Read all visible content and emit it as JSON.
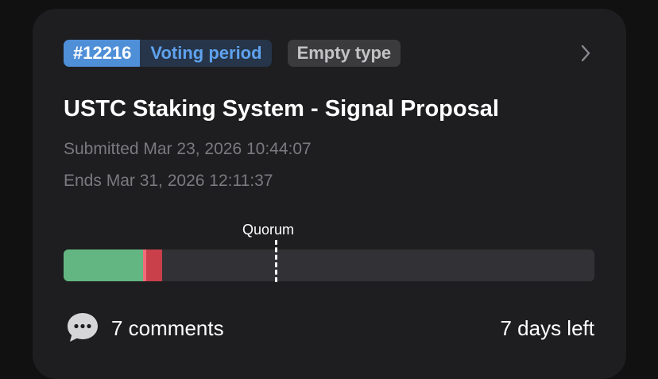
{
  "proposal": {
    "id_label": "#12216",
    "status_label": "Voting period",
    "type_label": "Empty type",
    "title": "USTC Staking System - Signal Proposal",
    "submitted": "Submitted Mar 23, 2026 10:44:07",
    "ends": "Ends Mar 31, 2026 12:11:37"
  },
  "tally": {
    "quorum_label": "Quorum",
    "yes_fraction": 0.15,
    "veto_fraction": 0.006,
    "no_fraction": 0.029,
    "quorum_fraction": 0.4,
    "colors": {
      "yes": "#63b682",
      "no": "#c9404b",
      "veto": "#f06c78",
      "track": "#323236"
    }
  },
  "footer": {
    "comment_icon": "speech-bubble-ellipsis-icon",
    "comments_label": "7 comments",
    "time_left": "7 days left"
  },
  "colors": {
    "accent": "#4f8fd8",
    "status_text": "#5fa2ee",
    "card_bg": "#1e1e20"
  }
}
